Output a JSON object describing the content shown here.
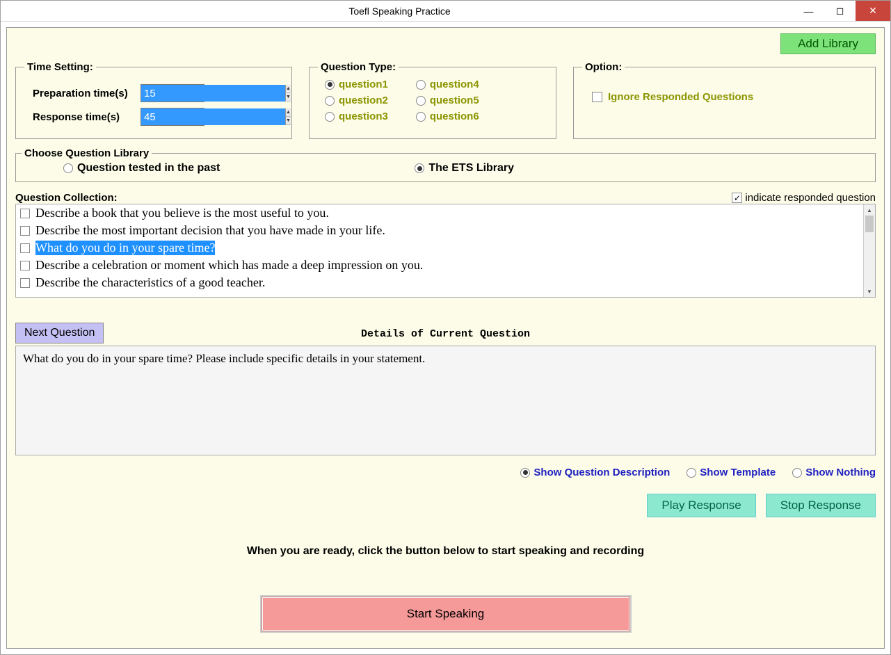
{
  "window": {
    "title": "Toefl Speaking Practice"
  },
  "buttons": {
    "add_library": "Add Library",
    "next_question": "Next Question",
    "play_response": "Play Response",
    "stop_response": "Stop Response",
    "start_speaking": "Start Speaking"
  },
  "time_setting": {
    "legend": "Time Setting:",
    "prep_label": "Preparation time(s)",
    "prep_value": "15",
    "resp_label": "Response time(s)",
    "resp_value": "45"
  },
  "question_type": {
    "legend": "Question Type:",
    "items": [
      "question1",
      "question2",
      "question3",
      "question4",
      "question5",
      "question6"
    ],
    "selected_index": 0
  },
  "option": {
    "legend": "Option:",
    "ignore_label": "Ignore Responded Questions"
  },
  "library": {
    "legend": "Choose Question Library",
    "opt1": "Question tested in the past",
    "opt2": "The ETS Library",
    "selected": 1
  },
  "collection": {
    "label": "Question Collection:",
    "indicate_label": "indicate responded question",
    "items": [
      "Describe a book that you believe is the most useful to you.",
      "Describe the most important decision that you have made in your life.",
      "What do you do in your spare time?",
      "Describe a celebration or moment which has made a deep impression on you.",
      "Describe the characteristics of a good teacher."
    ],
    "selected_index": 2
  },
  "details": {
    "label": "Details of Current Question",
    "text": "What do you do in your spare time? Please include specific details in your statement."
  },
  "show_options": {
    "desc": "Show Question Description",
    "template": "Show Template",
    "nothing": "Show Nothing",
    "selected": 0
  },
  "ready_text": "When you are ready, click the button below to start speaking and recording"
}
